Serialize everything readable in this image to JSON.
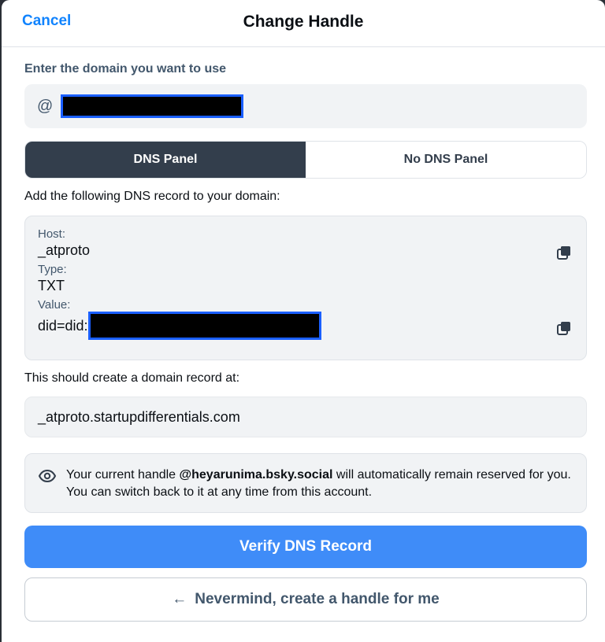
{
  "header": {
    "cancel_label": "Cancel",
    "title": "Change Handle"
  },
  "domain": {
    "label": "Enter the domain you want to use",
    "at_symbol": "@",
    "value_redacted": true
  },
  "tabs": [
    {
      "label": "DNS Panel",
      "active": true
    },
    {
      "label": "No DNS Panel",
      "active": false
    }
  ],
  "instruction": "Add the following DNS record to your domain:",
  "record": {
    "host_label": "Host:",
    "host_value": "_atproto",
    "type_label": "Type:",
    "type_value": "TXT",
    "value_label": "Value:",
    "value_prefix": "did=did:"
  },
  "record_at": {
    "label": "This should create a domain record at:",
    "value": "_atproto.startupdifferentials.com"
  },
  "notice": {
    "prefix": "Your current handle ",
    "handle": "@heyarunima.bsky.social",
    "suffix": " will automatically remain reserved for you. You can switch back to it at any time from this account."
  },
  "buttons": {
    "verify": "Verify DNS Record",
    "nevermind": "Nevermind, create a handle for me",
    "nevermind_arrow": "←"
  },
  "colors": {
    "accent": "#3f8cf8",
    "link": "#1083fe",
    "active_tab": "#333e4c"
  }
}
